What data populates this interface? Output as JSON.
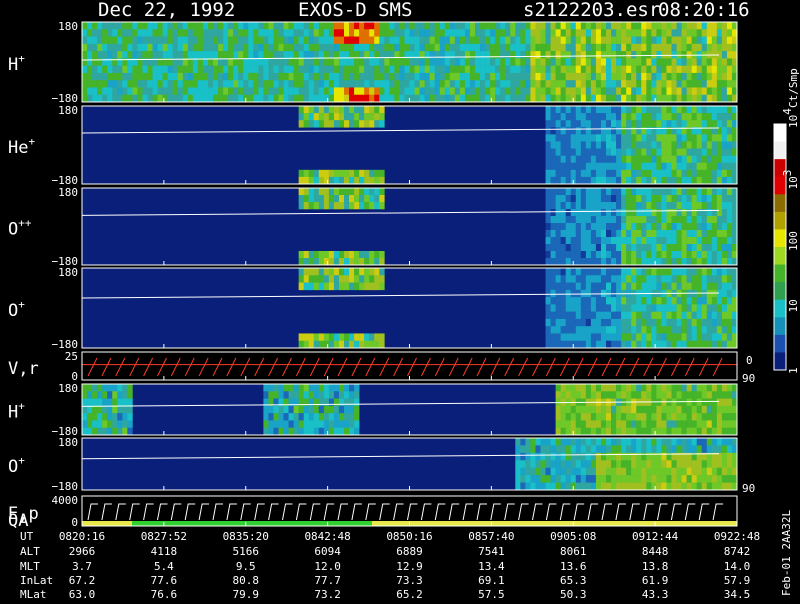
{
  "header": {
    "date": "Dec 22, 1992",
    "instrument": "EXOS-D SMS",
    "file": "s2122203.esr",
    "time": "08:20:16"
  },
  "chart_data": {
    "type": "heatmap",
    "panels": [
      {
        "label": "H",
        "superscript": "+",
        "ytop": "180",
        "ybottom": "−180",
        "kind": "pitch",
        "profile": "h1",
        "line_y": 0.45
      },
      {
        "label": "He",
        "superscript": "+",
        "ytop": "180",
        "ybottom": "−180",
        "kind": "pitch",
        "profile": "he",
        "line_y": 0.32
      },
      {
        "label": "O",
        "superscript": "++",
        "ytop": "180",
        "ybottom": "−180",
        "kind": "pitch",
        "profile": "opp",
        "line_y": 0.33
      },
      {
        "label": "O",
        "superscript": "+",
        "ytop": "180",
        "ybottom": "−180",
        "kind": "pitch",
        "profile": "op",
        "line_y": 0.35
      },
      {
        "label": "V,r",
        "superscript": "",
        "ytop": "25",
        "ybottom": "0",
        "kind": "sawtooth",
        "right_tick": "90",
        "right_bottom": "0"
      },
      {
        "label": "H",
        "superscript": "+",
        "ytop": "180",
        "ybottom": "−180",
        "kind": "pitch",
        "profile": "h2",
        "line_y": 0.4
      },
      {
        "label": "O",
        "superscript": "+",
        "ytop": "180",
        "ybottom": "−180",
        "kind": "pitch",
        "profile": "o2",
        "line_y": 0.36,
        "right_tick": "90"
      },
      {
        "label": "E,p",
        "label2": "QA",
        "superscript": "",
        "ytop": "4000",
        "ybottom": "0",
        "kind": "ep"
      }
    ],
    "colorbar": {
      "unit": "Ct/Smp",
      "ticks": [
        "10",
        "10",
        "100",
        "10",
        "1"
      ],
      "tick_exponents": [
        "4",
        "3",
        "",
        "",
        ""
      ],
      "tick_values": [
        10000,
        1000,
        100,
        10,
        1
      ],
      "scale": "log",
      "range": [
        1,
        10000
      ]
    },
    "table": {
      "row_labels": [
        "UT",
        "ALT",
        "MLT",
        "InLat",
        "MLat"
      ],
      "columns": [
        [
          "0820:16",
          "2966",
          "3.7",
          "67.2",
          "63.0"
        ],
        [
          "0827:52",
          "4118",
          "5.4",
          "77.6",
          "76.6"
        ],
        [
          "0835:20",
          "5166",
          "9.5",
          "80.8",
          "79.9"
        ],
        [
          "0842:48",
          "6094",
          "12.0",
          "77.7",
          "73.2"
        ],
        [
          "0850:16",
          "6889",
          "12.9",
          "73.3",
          "65.2"
        ],
        [
          "0857:40",
          "7541",
          "13.4",
          "69.1",
          "57.5"
        ],
        [
          "0905:08",
          "8061",
          "13.6",
          "65.3",
          "50.3"
        ],
        [
          "0912:44",
          "8448",
          "13.8",
          "61.9",
          "43.3"
        ],
        [
          "0922:48",
          "8742",
          "14.0",
          "57.9",
          "34.5"
        ]
      ]
    },
    "footer": "Feb-01 2AA32L",
    "colors": {
      "background": "#000000",
      "low": "#0a1f7a",
      "cyan": "#19c0c8",
      "green": "#46b428",
      "yellow": "#e6e600",
      "red": "#e00000",
      "sawtooth": "#ff3b2a",
      "qa_green": "#2fd02f",
      "qa_yellow": "#e8e84a"
    }
  }
}
